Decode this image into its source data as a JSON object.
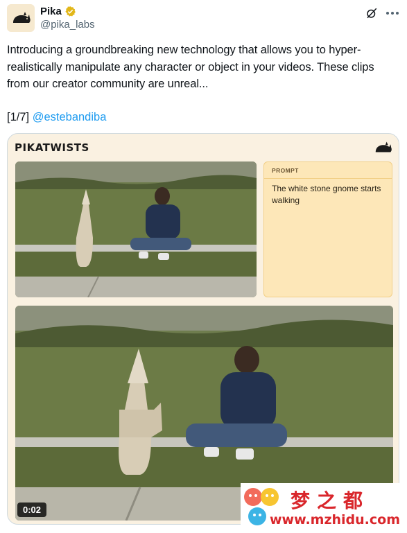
{
  "author": {
    "name": "Pika",
    "handle": "@pika_labs",
    "verified_color": "#e2b719"
  },
  "tweet": {
    "text": "Introducing a groundbreaking new technology that allows you to hyper-realistically manipulate any character or object in your videos. These clips from our creator community are unreal...",
    "ref_prefix": "[1/7] ",
    "mention": "@estebandiba"
  },
  "media": {
    "title": "PIKATWISTS",
    "prompt_label": "PROMPT",
    "prompt_text": "The white stone gnome starts walking",
    "duration": "0:02"
  },
  "watermark": {
    "big": "梦之都",
    "small": "www.mzhidu.com"
  },
  "colors": {
    "accent": "#1d9bf0",
    "prompt_bg": "#fde7b8",
    "media_bg": "#faf1e1",
    "watermark": "#d9262b"
  },
  "icons": [
    "pika-logo-icon",
    "verified-badge-icon",
    "grok-icon",
    "more-icon"
  ]
}
